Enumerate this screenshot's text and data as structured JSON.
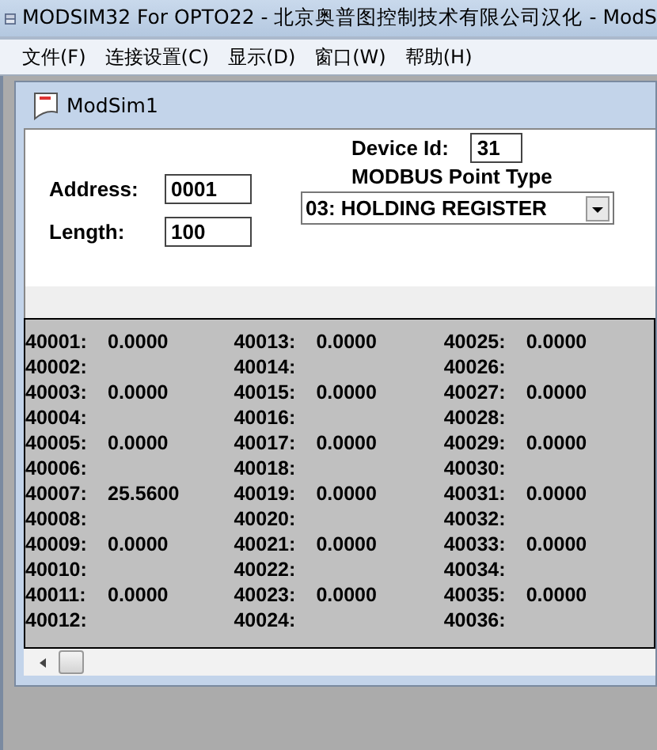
{
  "window": {
    "title": "MODSIM32 For OPTO22 - 北京奥普图控制技术有限公司汉化 - ModS"
  },
  "menu": [
    "文件(F)",
    "连接设置(C)",
    "显示(D)",
    "窗口(W)",
    "帮助(H)"
  ],
  "child_window": {
    "title": "ModSim1"
  },
  "form": {
    "device_id_label": "Device Id:",
    "device_id": "31",
    "address_label": "Address:",
    "address": "0001",
    "length_label": "Length:",
    "length": "100",
    "point_type_label": "MODBUS Point Type",
    "point_type": "03: HOLDING REGISTER"
  },
  "registers": [
    [
      {
        "address": "40001:",
        "value": "0.0000"
      },
      {
        "address": "40002:"
      },
      {
        "address": "40003:",
        "value": "0.0000"
      },
      {
        "address": "40004:"
      },
      {
        "address": "40005:",
        "value": "0.0000"
      },
      {
        "address": "40006:"
      },
      {
        "address": "40007:",
        "value": "25.5600"
      },
      {
        "address": "40008:"
      },
      {
        "address": "40009:",
        "value": "0.0000"
      },
      {
        "address": "40010:"
      },
      {
        "address": "40011:",
        "value": "0.0000"
      },
      {
        "address": "40012:"
      }
    ],
    [
      {
        "address": "40013:",
        "value": "0.0000"
      },
      {
        "address": "40014:"
      },
      {
        "address": "40015:",
        "value": "0.0000"
      },
      {
        "address": "40016:"
      },
      {
        "address": "40017:",
        "value": "0.0000"
      },
      {
        "address": "40018:"
      },
      {
        "address": "40019:",
        "value": "0.0000"
      },
      {
        "address": "40020:"
      },
      {
        "address": "40021:",
        "value": "0.0000"
      },
      {
        "address": "40022:"
      },
      {
        "address": "40023:",
        "value": "0.0000"
      },
      {
        "address": "40024:"
      }
    ],
    [
      {
        "address": "40025:",
        "value": "0.0000"
      },
      {
        "address": "40026:"
      },
      {
        "address": "40027:",
        "value": "0.0000"
      },
      {
        "address": "40028:"
      },
      {
        "address": "40029:",
        "value": "0.0000"
      },
      {
        "address": "40030:"
      },
      {
        "address": "40031:",
        "value": "0.0000"
      },
      {
        "address": "40032:"
      },
      {
        "address": "40033:",
        "value": "0.0000"
      },
      {
        "address": "40034:"
      },
      {
        "address": "40035:",
        "value": "0.0000"
      },
      {
        "address": "40036:"
      }
    ]
  ]
}
